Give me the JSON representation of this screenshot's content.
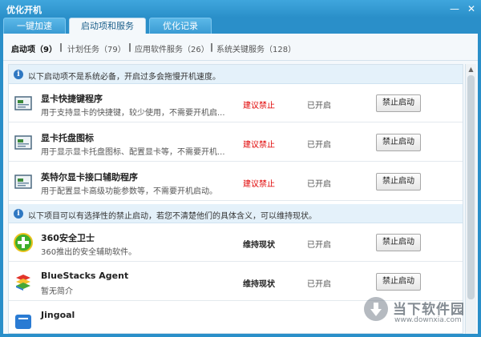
{
  "window": {
    "title": "优化开机",
    "min_glyph": "—",
    "close_glyph": "✕"
  },
  "tabs": [
    {
      "label": "一键加速",
      "active": false
    },
    {
      "label": "启动项和服务",
      "active": true
    },
    {
      "label": "优化记录",
      "active": false
    }
  ],
  "subnav": [
    {
      "label": "启动项（9）",
      "active": true
    },
    {
      "label": "计划任务（79）",
      "active": false
    },
    {
      "label": "应用软件服务（26）",
      "active": false
    },
    {
      "label": "系统关键服务（128）",
      "active": false
    }
  ],
  "subnav_separator": "|",
  "notice1": "以下启动项不是系统必备，开启过多会拖慢开机速度。",
  "notice2": "以下项目可以有选择性的禁止启动，若您不清楚他们的具体含义，可以维持现状。",
  "rows_group1": [
    {
      "icon": "display-card-icon",
      "name": "显卡快捷键程序",
      "desc": "用于支持显卡的快捷键，较少使用，不需要开机启...",
      "advice": "建议禁止",
      "status": "已开启",
      "button": "禁止启动"
    },
    {
      "icon": "display-card-icon",
      "name": "显卡托盘图标",
      "desc": "用于显示显卡托盘图标、配置显卡等，不需要开机...",
      "advice": "建议禁止",
      "status": "已开启",
      "button": "禁止启动"
    },
    {
      "icon": "display-card-icon",
      "name": "英特尔显卡接口辅助程序",
      "desc": "用于配置显卡高级功能参数等，不需要开机启动。",
      "advice": "建议禁止",
      "status": "已开启",
      "button": "禁止启动"
    }
  ],
  "rows_group2": [
    {
      "icon": "360-safe-icon",
      "name": "360安全卫士",
      "desc": "360推出的安全辅助软件。",
      "advice": "维持现状",
      "status": "已开启",
      "button": "禁止启动"
    },
    {
      "icon": "bluestacks-icon",
      "name": "BlueStacks Agent",
      "desc": "暂无简介",
      "advice": "维持现状",
      "status": "已开启",
      "button": "禁止启动"
    },
    {
      "icon": "jingoal-icon",
      "name": "Jingoal",
      "desc": "",
      "advice": "",
      "status": "",
      "button": ""
    }
  ],
  "watermark": {
    "title": "当下软件园",
    "url": "www.downxia.com"
  },
  "colors": {
    "title_bar": "#2a8fc9",
    "advice_red": "#e00000",
    "notice_bg": "#e4f1fa"
  }
}
